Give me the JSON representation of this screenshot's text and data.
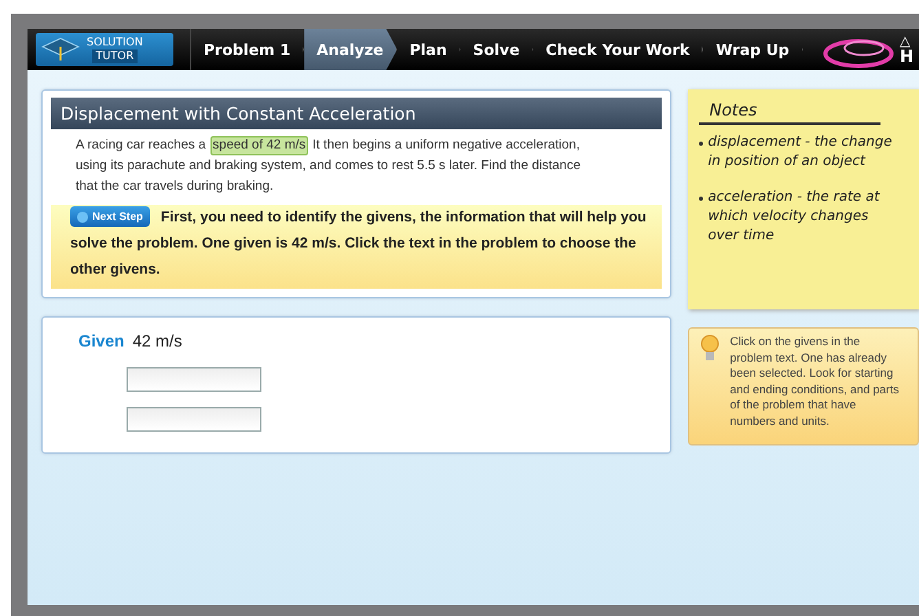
{
  "logo": {
    "line1": "SOLUTION",
    "line2": "TUTOR"
  },
  "tabs": [
    {
      "label": "Problem 1",
      "selected": false
    },
    {
      "label": "Analyze",
      "selected": true
    },
    {
      "label": "Plan",
      "selected": false
    },
    {
      "label": "Solve",
      "selected": false
    },
    {
      "label": "Check Your Work",
      "selected": false
    },
    {
      "label": "Wrap Up",
      "selected": false
    }
  ],
  "brand": {
    "mark": "△",
    "text": "H"
  },
  "problem": {
    "title": "Displacement with Constant Acceleration",
    "lines": [
      {
        "segments": [
          {
            "text": "A racing car reaches a",
            "selected": false
          },
          {
            "text": "speed of 42 m/s",
            "selected": true
          },
          {
            "text": "It then begins a uniform negative acceleration,",
            "selected": false
          }
        ]
      },
      {
        "segments": [
          {
            "text": "using its parachute and braking system, and comes to rest 5.5 s later. Find the distance",
            "selected": false
          }
        ]
      },
      {
        "segments": [
          {
            "text": "that the car travels during braking.",
            "selected": false
          }
        ]
      }
    ]
  },
  "step": {
    "button": "Next Step",
    "lines": [
      "First, you need to identify the givens, the information that will help you",
      "solve the problem. One given is 42 m/s. Click the text in the problem to choose the",
      "other givens."
    ]
  },
  "givens": {
    "label": "Given",
    "value": "42 m/s",
    "fields": [
      {
        "kind": "input"
      },
      {
        "kind": "input"
      }
    ]
  },
  "notes": {
    "title": "Notes",
    "items": [
      "displacement - the change in position of an object",
      "acceleration - the rate at which velocity changes over time"
    ]
  },
  "hint": {
    "text": "Click on the givens in the problem text. One has already been selected. Look for starting and ending conditions, and parts of the problem that have numbers and units."
  }
}
